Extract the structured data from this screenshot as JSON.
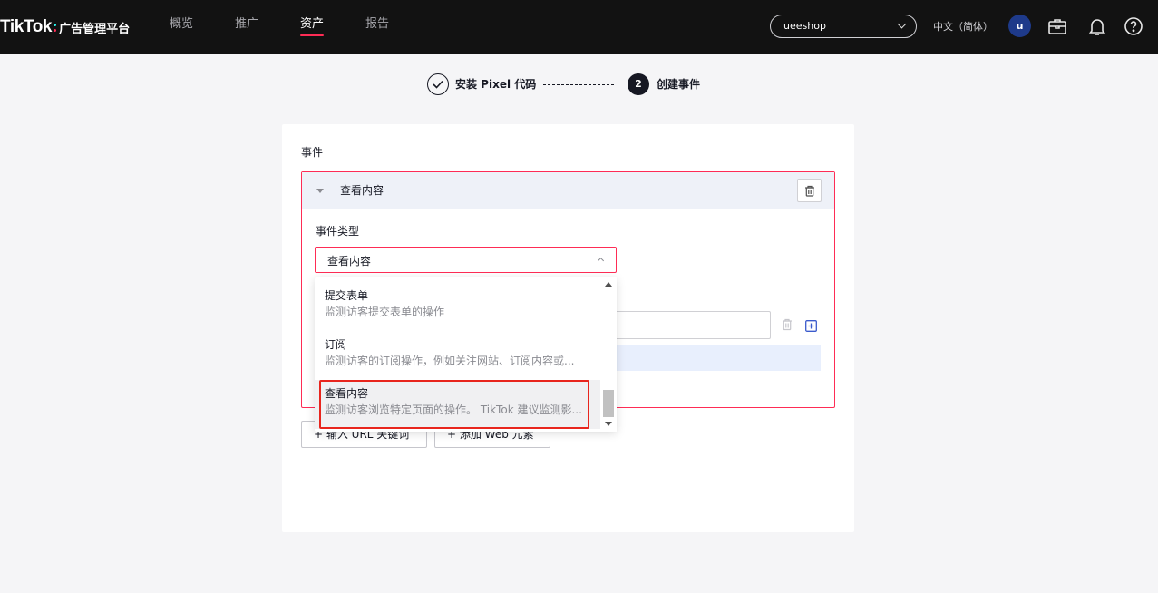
{
  "brand": {
    "name": "TikTok",
    "subtitle": "广告管理平台"
  },
  "nav": {
    "items": [
      {
        "label": "概览",
        "active": false
      },
      {
        "label": "推广",
        "active": false
      },
      {
        "label": "资产",
        "active": true
      },
      {
        "label": "报告",
        "active": false
      }
    ]
  },
  "header": {
    "account": "ueeshop",
    "language": "中文（简体）",
    "avatar_letter": "u",
    "icons": [
      "briefcase-icon",
      "bell-icon",
      "help-icon"
    ]
  },
  "stepper": {
    "step1": {
      "label": "安装 Pixel 代码",
      "status": "done"
    },
    "step2": {
      "number": "2",
      "label": "创建事件",
      "status": "current"
    }
  },
  "card": {
    "section_label": "事件",
    "event": {
      "title": "查看内容",
      "type_label": "事件类型",
      "selected_type": "查看内容"
    },
    "buttons": {
      "add_url_keyword": "+ 输入 URL 关键词",
      "add_web_element": "+ 添加 Web 元素"
    }
  },
  "dropdown": {
    "options": [
      {
        "title": "提交表单",
        "description": "监测访客提交表单的操作"
      },
      {
        "title": "订阅",
        "description": "监测访客的订阅操作，例如关注网站、订阅内容或..."
      },
      {
        "title": "查看内容",
        "description": "监测访客浏览特定页面的操作。 TikTok 建议监测影...",
        "selected": true
      }
    ]
  },
  "colors": {
    "topbar": "#121212",
    "accent": "#fe2c55",
    "highlight": "#e8251d",
    "header_bg": "#eef1f8"
  }
}
